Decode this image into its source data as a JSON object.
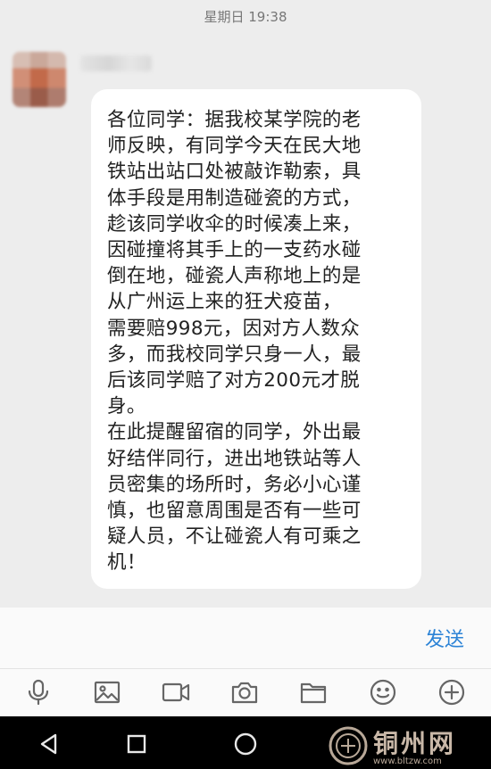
{
  "status": {
    "timestamp": "星期日 19:38"
  },
  "message": {
    "lines": [
      "各位同学：据我校某学院的老",
      "师反映，有同学今天在民大地",
      "铁站出站口处被敲诈勒索，具",
      "体手段是用制造碰瓷的方式，",
      "趁该同学收伞的时候凑上来，",
      "因碰撞将其手上的一支药水碰",
      "倒在地，碰瓷人声称地上的是",
      "从广州运上来的狂犬疫苗，",
      "需要赔998元，因对方人数众",
      "多，而我校同学只身一人，最",
      "后该同学赔了对方200元才脱",
      "身。",
      "在此提醒留宿的同学，外出最",
      "好结伴同行，进出地铁站等人",
      "员密集的场所时，务必小心谨",
      "慎，也留意周围是否有一些可",
      "疑人员，不让碰瓷人有可乘之",
      "机！"
    ]
  },
  "input": {
    "send_label": "发送"
  },
  "toolbar": {
    "icons": [
      "microphone-icon",
      "image-icon",
      "video-icon",
      "camera-icon",
      "folder-icon",
      "emoji-icon",
      "plus-icon"
    ]
  },
  "navbar": {
    "icons": [
      "back-icon",
      "home-icon",
      "recents-icon"
    ]
  },
  "watermark": {
    "text": "铜州网",
    "url": "www.bltzw.com"
  },
  "colors": {
    "accent": "#2c83d6",
    "chat_bg": "#ededed",
    "bubble": "#ffffff",
    "nav_bg": "#000000"
  }
}
